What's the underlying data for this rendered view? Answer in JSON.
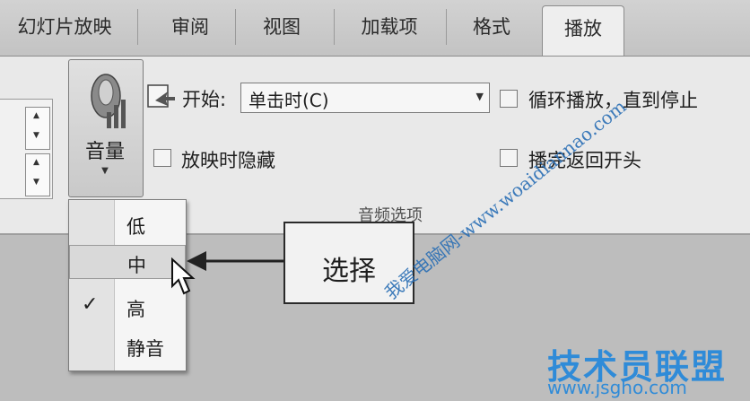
{
  "tabs": [
    {
      "label": "幻灯片放映"
    },
    {
      "label": "审阅"
    },
    {
      "label": "视图"
    },
    {
      "label": "加载项"
    },
    {
      "label": "格式"
    },
    {
      "label": "播放"
    }
  ],
  "ribbon": {
    "volume_button": {
      "label": "音量",
      "icon": "speaker-icon"
    },
    "start": {
      "label": "开始:",
      "value": "单击时(C)"
    },
    "checkboxes": {
      "hide_during_show": {
        "label": "放映时隐藏",
        "checked": false
      },
      "loop_until_stopped": {
        "label": "循环播放，直到停止",
        "checked": false
      },
      "rewind_after_playing": {
        "label": "播完返回开头",
        "checked": false
      }
    },
    "group_label": "音频选项"
  },
  "volume_menu": {
    "items": [
      {
        "label": "低",
        "checked": false
      },
      {
        "label": "中",
        "checked": false,
        "hover": true
      },
      {
        "label": "高",
        "checked": true
      },
      {
        "label": "静音",
        "checked": false
      }
    ],
    "check_glyph": "✓"
  },
  "annotation": {
    "label": "选择"
  },
  "watermarks": {
    "url": "我爱电脑网-www.woaidiannao.com",
    "site": "技术员联盟",
    "domain": "www.jsgho.com"
  },
  "colors": {
    "watermark_blue": "#2f8bd8"
  }
}
